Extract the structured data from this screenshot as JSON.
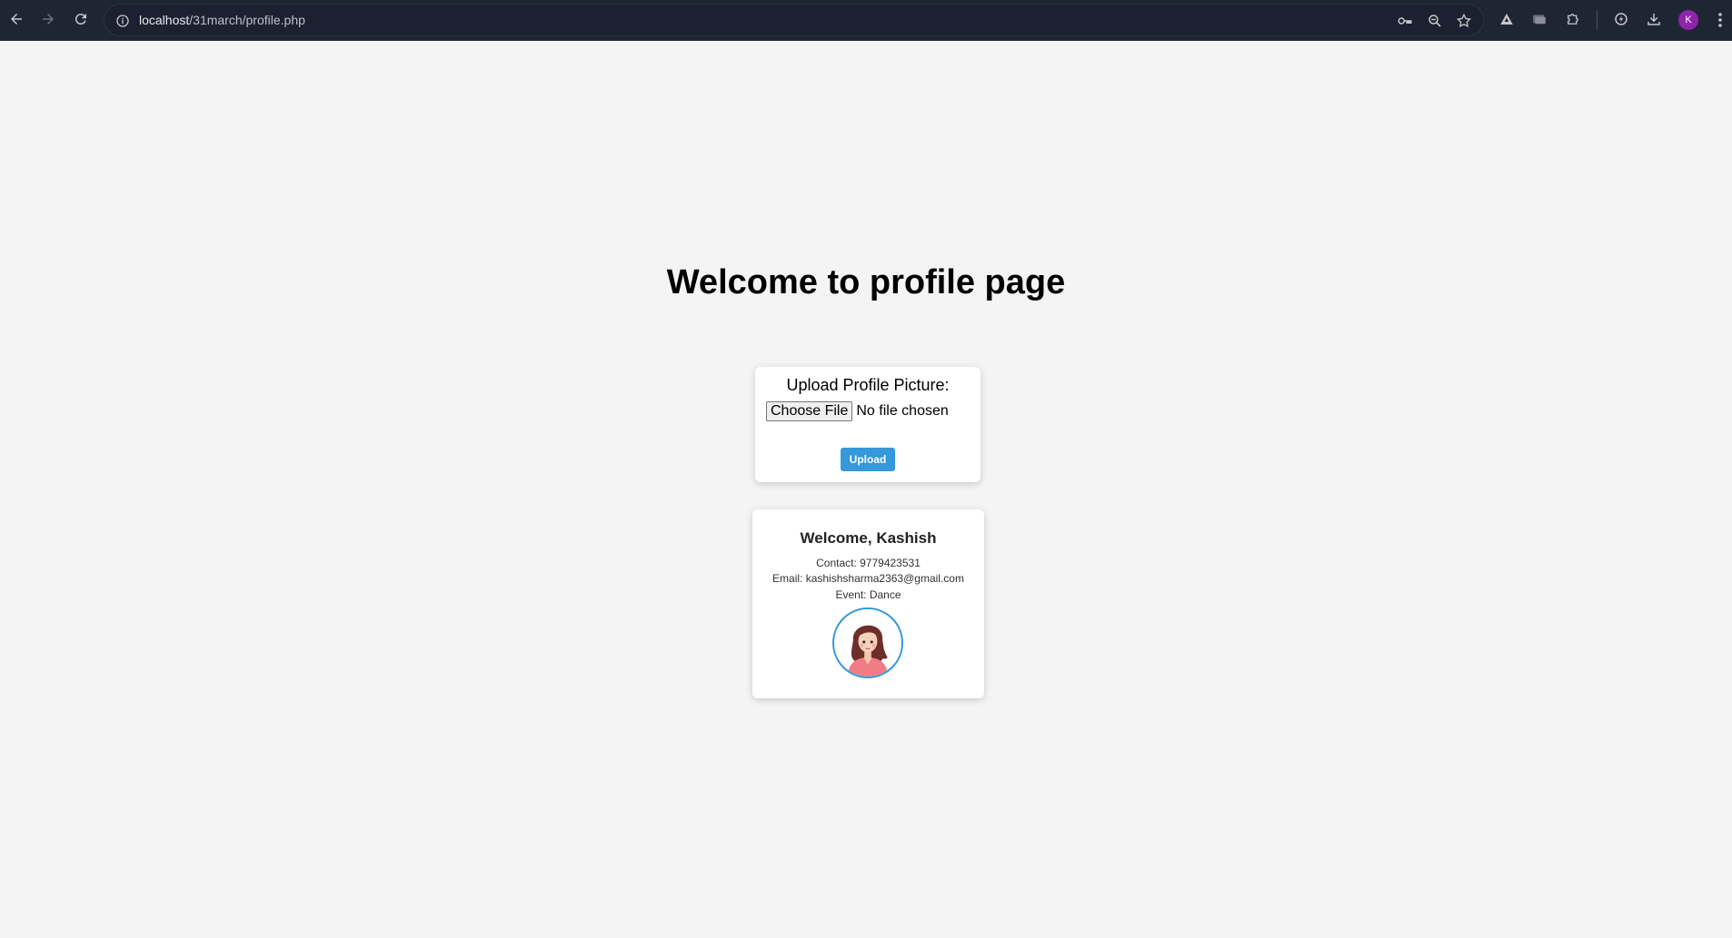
{
  "browser": {
    "url_host": "localhost",
    "url_path": "/31march/profile.php",
    "profile_initial": "K",
    "icons": {
      "back": "back-arrow-icon",
      "forward": "forward-arrow-icon",
      "reload": "reload-icon",
      "site_info": "info-icon",
      "password": "key-icon",
      "zoom": "zoom-icon",
      "bookmark": "star-icon",
      "extensions": [
        "triangle-extension-icon",
        "folder-extension-icon",
        "puzzle-extensions-icon",
        "performance-icon",
        "download-icon"
      ],
      "menu": "more-vert-icon"
    }
  },
  "page": {
    "heading": "Welcome to profile page",
    "upload_form": {
      "label": "Upload Profile Picture:",
      "choose_file_label": "Choose File",
      "file_status": "No file chosen",
      "upload_button": "Upload"
    },
    "profile": {
      "welcome": "Welcome, Kashish",
      "contact": "Contact: 9779423531",
      "email": "Email: kashishsharma2363@gmail.com",
      "event": "Event: Dance",
      "avatar": "profile-picture-girl-illustration"
    }
  },
  "colors": {
    "toolbar_bg": "#1f2633",
    "page_bg": "#f4f4f4",
    "accent": "#3498db",
    "avatar_profile": "#8e24aa"
  }
}
